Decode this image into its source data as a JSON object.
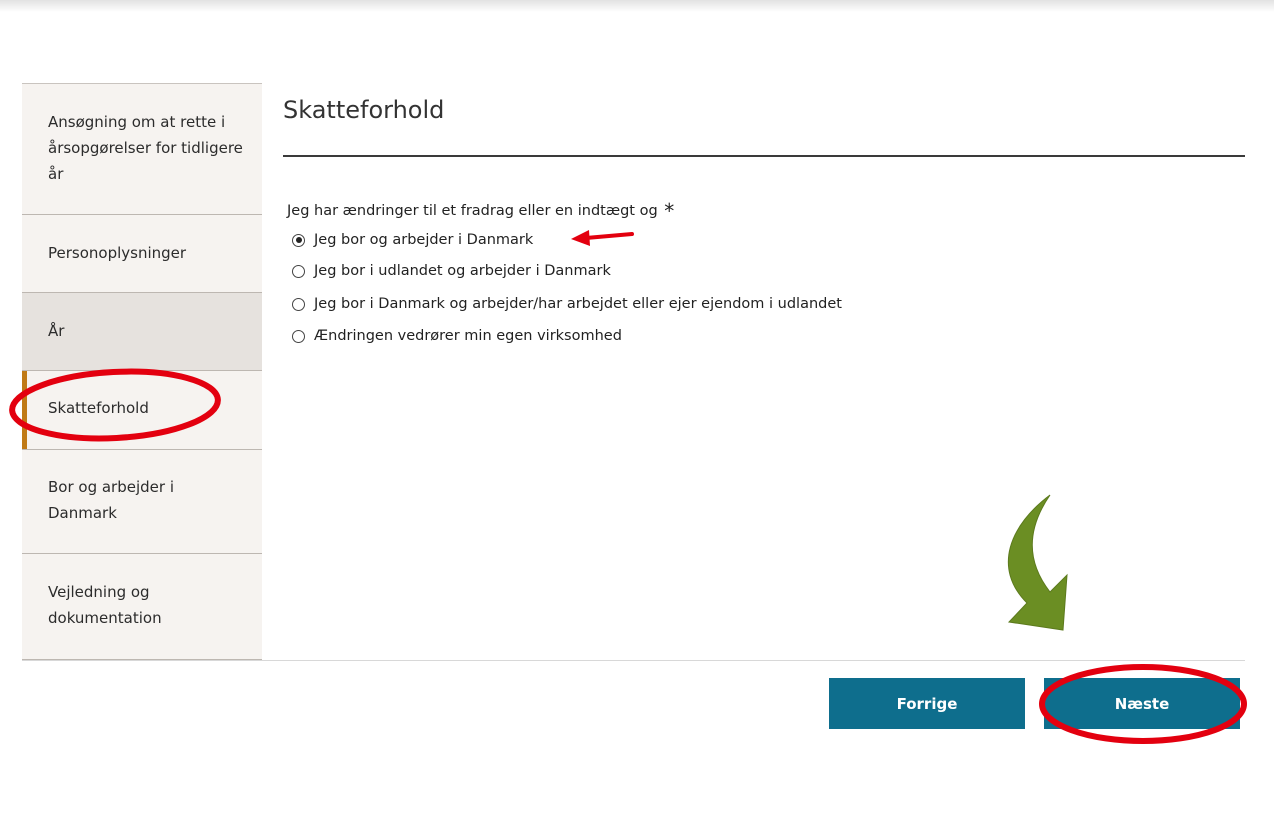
{
  "sidebar": {
    "items": [
      {
        "label": "Ansøgning om at rette i årsopgørelser for tidligere år"
      },
      {
        "label": "Personoplysninger"
      },
      {
        "label": "År"
      },
      {
        "label": "Skatteforhold"
      },
      {
        "label": "Bor og arbejder i Danmark"
      },
      {
        "label": "Vejledning og dokumentation"
      }
    ]
  },
  "main": {
    "title": "Skatteforhold",
    "question": "Jeg har ændringer til et fradrag eller en indtægt og",
    "required_marker": "*",
    "options": [
      {
        "label": "Jeg bor og arbejder i Danmark",
        "selected": true
      },
      {
        "label": "Jeg bor i udlandet og arbejder i Danmark",
        "selected": false
      },
      {
        "label": "Jeg bor i Danmark og arbejder/har arbejdet eller ejer ejendom i udlandet",
        "selected": false
      },
      {
        "label": "Ændringen vedrører min egen virksomhed",
        "selected": false
      }
    ]
  },
  "footer": {
    "prev_label": "Forrige",
    "next_label": "Næste"
  },
  "colors": {
    "button": "#0e6e8d",
    "active_marker": "#c07a16",
    "annotation_red": "#e3000f",
    "annotation_green": "#6b8e23"
  }
}
